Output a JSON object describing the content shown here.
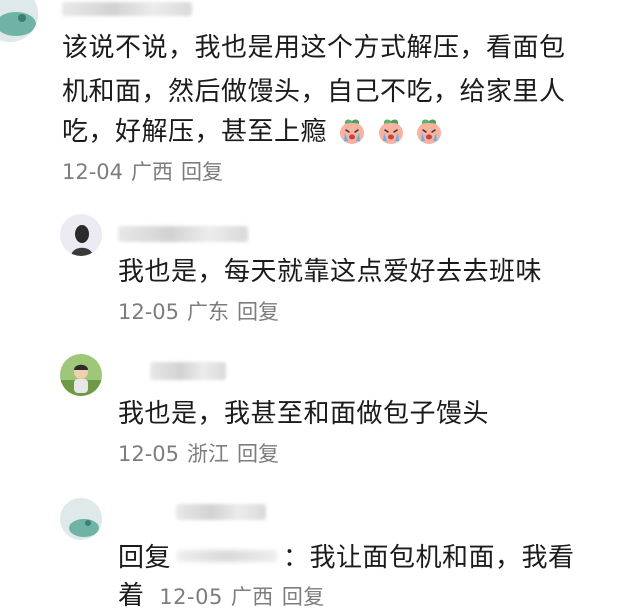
{
  "comments": [
    {
      "avatar_icon": "avatar-green-icon",
      "text_lines": [
        "该说不说，我也是用这个方式解压，看面包",
        "机和面，然后做馒头，自己不吃，给家里人",
        "吃，好解压，甚至上瘾"
      ],
      "emoji_icons": [
        "crying-peach-emoji-icon",
        "crying-peach-emoji-icon",
        "crying-peach-emoji-icon"
      ],
      "date": "12-04",
      "location": "广西",
      "reply_label": "回复"
    },
    {
      "avatar_icon": "avatar-girl-icon",
      "text": "我也是，每天就靠这点爱好去去班味",
      "date": "12-05",
      "location": "广东",
      "reply_label": "回复"
    },
    {
      "avatar_icon": "avatar-child-photo-icon",
      "text": "我也是，我甚至和面做包子馒头",
      "date": "12-05",
      "location": "浙江",
      "reply_label": "回复"
    },
    {
      "avatar_icon": "avatar-green-icon",
      "reply_prefix": "回复",
      "text_rest": "：我让面包机和面，我看",
      "text_line2": "着",
      "date": "12-05",
      "location": "广西",
      "reply_label": "回复"
    }
  ],
  "colors": {
    "text": "#1b1b1b",
    "meta": "#7d7d7d",
    "background": "#ffffff"
  }
}
